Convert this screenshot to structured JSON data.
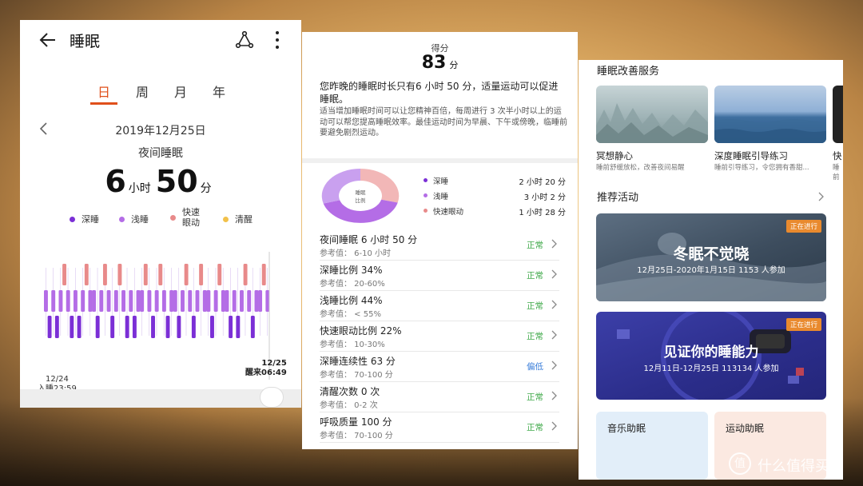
{
  "colors": {
    "accent": "#e0501b",
    "deep": "#7b2fd6",
    "light": "#b46de6",
    "rem": "#e88a8a",
    "awake": "#f2c14a",
    "normal": "#40a94a",
    "low": "#3a7ed9"
  },
  "left_panel": {
    "title": "睡眠",
    "tabs": [
      {
        "label": "日",
        "active": true
      },
      {
        "label": "周",
        "active": false
      },
      {
        "label": "月",
        "active": false
      },
      {
        "label": "年",
        "active": false
      }
    ],
    "date": "2019年12月25日",
    "subtitle": "夜间睡眠",
    "duration": {
      "hours": "6",
      "hours_unit": "小时",
      "minutes": "50",
      "minutes_unit": "分"
    },
    "legend": [
      "深睡",
      "浅睡",
      "快速眼动",
      "清醒"
    ],
    "chart": {
      "start_date": "12/24",
      "start_label": "入睡23:59",
      "end_date": "12/25",
      "end_label": "醒来06:49"
    }
  },
  "middle_panel": {
    "score_label": "得分",
    "score": "83",
    "score_unit": "分",
    "advice": "您昨晚的睡眠时长只有6 小时 50 分，适量运动可以促进睡眠。",
    "detail": "适当增加睡眠时间可以让您精神百倍，每周进行 3 次半小时以上的运动可以帮您提高睡眠效率。最佳运动时间为早晨、下午或傍晚，临睡前要避免剧烈运动。",
    "donut_label_1": "睡眠",
    "donut_label_2": "比例",
    "ratios": [
      {
        "label": "深睡",
        "value": "2 小时 20 分"
      },
      {
        "label": "浅睡",
        "value": "3 小时 2 分"
      },
      {
        "label": "快速眼动",
        "value": "1 小时 28 分"
      }
    ],
    "metrics": [
      {
        "name": "夜间睡眠  6 小时 50 分",
        "ref": "参考值：  6-10 小时",
        "status": "正常"
      },
      {
        "name": "深睡比例  34%",
        "ref": "参考值：  20-60%",
        "status": "正常"
      },
      {
        "name": "浅睡比例  44%",
        "ref": "参考值：  < 55%",
        "status": "正常"
      },
      {
        "name": "快速眼动比例  22%",
        "ref": "参考值：  10-30%",
        "status": "正常"
      },
      {
        "name": "深睡连续性  63 分",
        "ref": "参考值：  70-100 分",
        "status": "偏低"
      },
      {
        "name": "清醒次数  0 次",
        "ref": "参考值：  0-2 次",
        "status": "正常"
      },
      {
        "name": "呼吸质量  100 分",
        "ref": "参考值：  70-100 分",
        "status": "正常"
      }
    ]
  },
  "right_panel": {
    "services_title": "睡眠改善服务",
    "services": [
      {
        "title": "冥想静心",
        "desc": "睡前舒缓放松，改善夜间易醒"
      },
      {
        "title": "深度睡眠引导练习",
        "desc": "睡前引导练习，令您拥有香甜..."
      },
      {
        "title": "快",
        "desc": "睡前"
      }
    ],
    "activities_title": "推荐活动",
    "activities": [
      {
        "title": "冬眠不觉晓",
        "sub": "12月25日-2020年1月15日    1153 人参加",
        "badge": "正在进行"
      },
      {
        "title": "见证你的睡能力",
        "sub": "12月11日-12月25日    113134 人参加",
        "badge": "正在进行"
      }
    ],
    "mini_cards": [
      {
        "title": "音乐助眠"
      },
      {
        "title": "运动助眠"
      }
    ]
  },
  "watermark": {
    "symbol": "值",
    "text": "什么值得买"
  }
}
